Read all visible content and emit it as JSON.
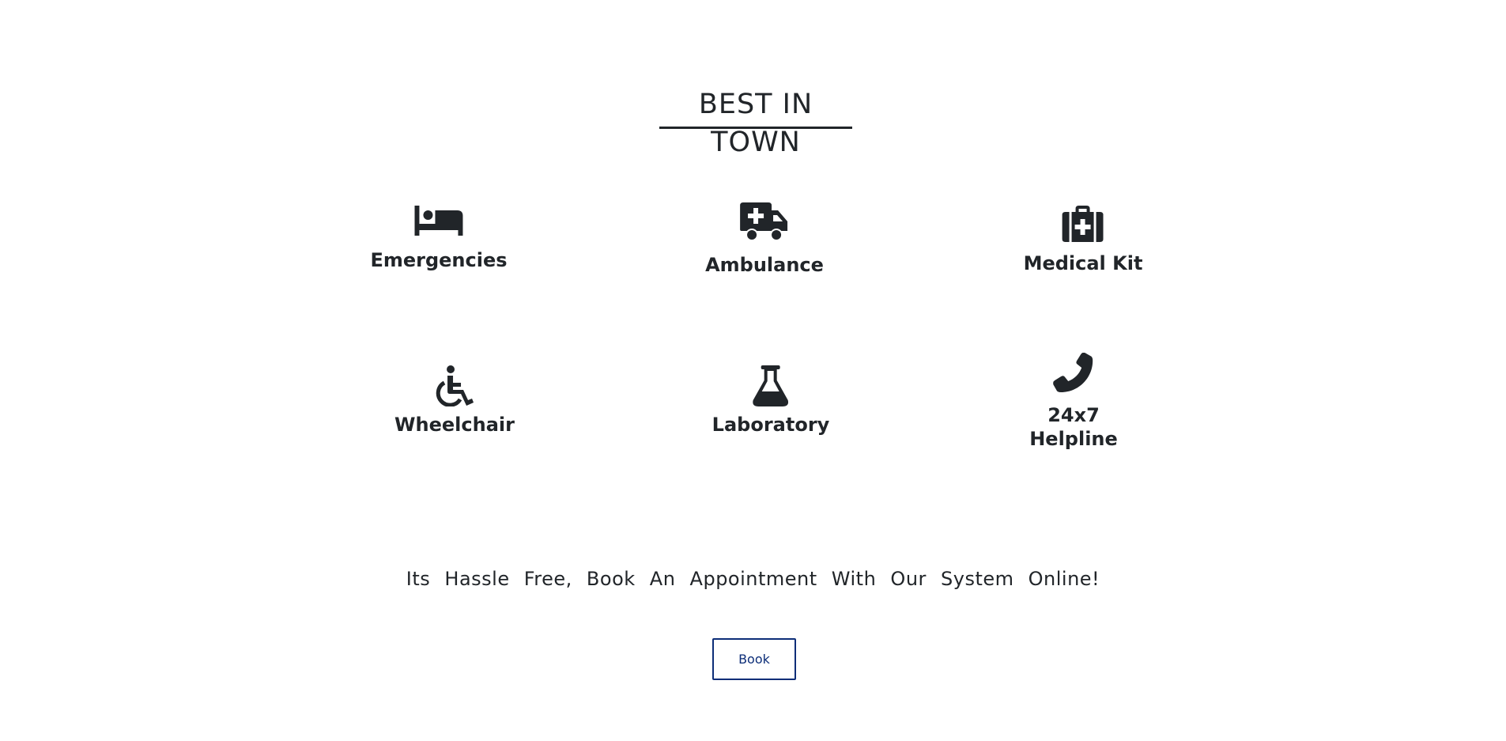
{
  "section": {
    "title": "BEST IN TOWN"
  },
  "services": [
    {
      "label": "Emergencies",
      "icon": "bed-icon"
    },
    {
      "label": "Ambulance",
      "icon": "ambulance-icon"
    },
    {
      "label": "Medical Kit",
      "icon": "medical-kit-icon"
    },
    {
      "label": "Wheelchair",
      "icon": "wheelchair-icon"
    },
    {
      "label": "Laboratory",
      "icon": "flask-icon"
    },
    {
      "label": "24x7 Helpline",
      "line1": "24x7",
      "line2": "Helpline",
      "icon": "phone-icon"
    }
  ],
  "cta": {
    "tagline": "Its Hassle Free, Book An Appointment With Our System Online!",
    "button_label": "Book"
  },
  "colors": {
    "text": "#212529",
    "button_border": "#0d2e78"
  }
}
